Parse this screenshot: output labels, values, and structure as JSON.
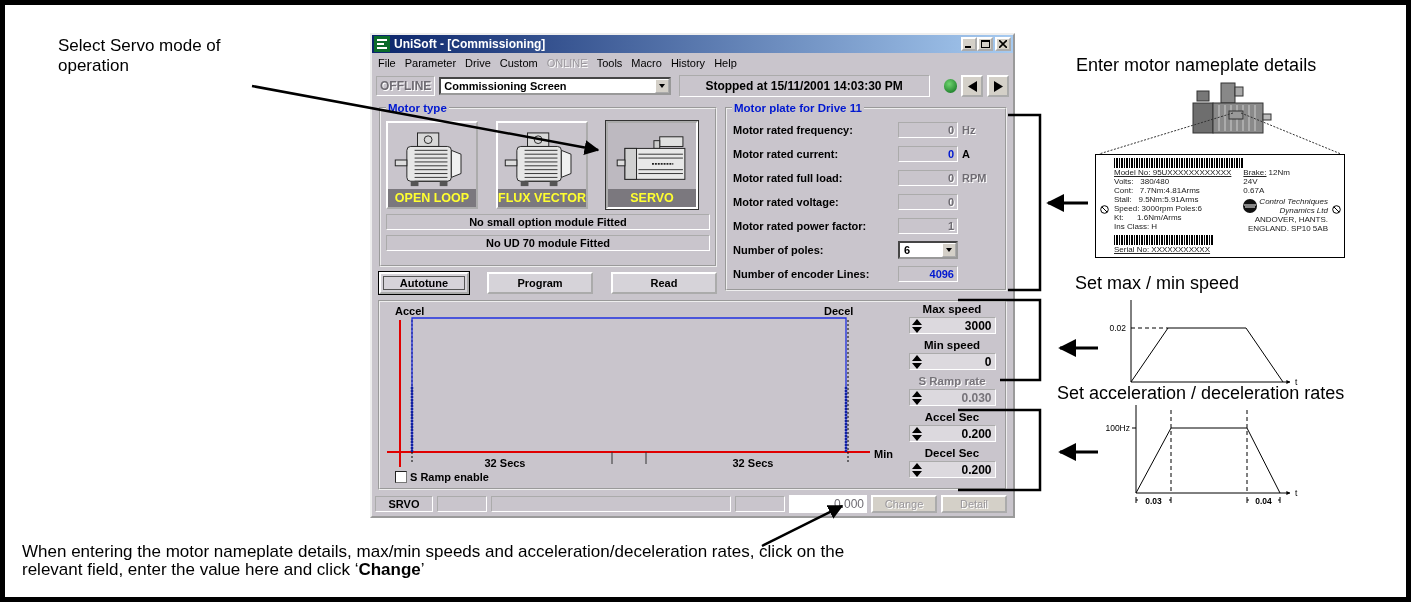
{
  "annotations": {
    "servo_note": "Select Servo mode of operation",
    "change_note": "When entering the motor nameplate details, max/min speeds and acceleration/deceleration rates, click on the relevant field, enter the value here and click ‘**Change**’"
  },
  "window": {
    "title": "UniSoft - [Commissioning]",
    "menu": [
      {
        "label": "File",
        "disabled": false
      },
      {
        "label": "Parameter",
        "disabled": false
      },
      {
        "label": "Drive",
        "disabled": false
      },
      {
        "label": "Custom",
        "disabled": false
      },
      {
        "label": "ONLINE",
        "disabled": true
      },
      {
        "label": "Tools",
        "disabled": false
      },
      {
        "label": "Macro",
        "disabled": false
      },
      {
        "label": "History",
        "disabled": false
      },
      {
        "label": "Help",
        "disabled": false
      }
    ],
    "toolbar": {
      "mode": "OFFLINE",
      "screen": "Commissioning Screen",
      "status": "Stopped at 15/11/2001 14:03:30 PM"
    },
    "motor_type": {
      "title": "Motor type",
      "options": [
        {
          "label": "OPEN LOOP",
          "kind": "induction",
          "selected": false
        },
        {
          "label": "FLUX VECTOR",
          "kind": "induction",
          "selected": false
        },
        {
          "label": "SERVO",
          "kind": "servo",
          "selected": true
        }
      ],
      "modules": [
        "No small option module Fitted",
        "No UD 70 module Fitted"
      ]
    },
    "buttons": [
      {
        "label": "Autotune",
        "focused": true
      },
      {
        "label": "Program",
        "focused": false
      },
      {
        "label": "Read",
        "focused": false
      }
    ],
    "motor_plate": {
      "title": "Motor plate for Drive 11",
      "fields": [
        {
          "label": "Motor rated frequency:",
          "kind": "text",
          "value": "0",
          "unit": "Hz",
          "disabled": true
        },
        {
          "label": "Motor rated current:",
          "kind": "text",
          "value": "0",
          "unit": "A",
          "disabled": false
        },
        {
          "label": "Motor rated full load:",
          "kind": "text",
          "value": "0",
          "unit": "RPM",
          "disabled": true
        },
        {
          "label": "Motor rated voltage:",
          "kind": "text",
          "value": "0",
          "disabled": true
        },
        {
          "label": "Motor rated power factor:",
          "kind": "text",
          "value": "1",
          "disabled": true
        },
        {
          "label": "Number of poles:",
          "kind": "dropdown",
          "value": "6"
        },
        {
          "label": "Number of encoder Lines:",
          "kind": "text",
          "value": "4096",
          "disabled": false
        }
      ]
    },
    "ramp": {
      "accel_label": "Accel",
      "decel_label": "Decel",
      "axis_label": "Min",
      "durations": [
        "32 Secs",
        "32 Secs"
      ],
      "s_ramp_enable": {
        "label": "S Ramp enable",
        "checked": false
      },
      "spinners": [
        {
          "label": "Max speed",
          "value": "3000",
          "disabled": false
        },
        {
          "label": "Min speed",
          "value": "0",
          "disabled": false
        },
        {
          "label": "S Ramp rate",
          "value": "0.030",
          "disabled": true
        },
        {
          "label": "Accel Sec",
          "value": "0.200",
          "disabled": false
        },
        {
          "label": "Decel Sec",
          "value": "0.200",
          "disabled": false
        }
      ]
    },
    "status_bar": {
      "mode": "SRVO",
      "value": "0.000",
      "buttons": [
        {
          "label": "Change",
          "disabled": true
        },
        {
          "label": "Detail",
          "disabled": true
        }
      ]
    }
  },
  "callouts": {
    "nameplate_title": "Enter motor nameplate details",
    "nameplate": {
      "model": "Model No: 95UXXXXXXXXXXXX",
      "left_lines": [
        "Volts:   380/480",
        "Cont:   7.7Nm:4.81Arms",
        "Stall:   9.5Nm:5.91Arms",
        "Speed: 3000rpm Poles:6",
        "Kt:      1.6Nm/Arms",
        "Ins Class: H"
      ],
      "brake": "Brake:",
      "right_lines": [
        "12Nm",
        "24V",
        "0.67A"
      ],
      "company": [
        "Control Techniques",
        "Dynamics Ltd"
      ],
      "address": [
        "ANDOVER, HANTS.",
        "ENGLAND. SP10 5AB"
      ],
      "serial": "Serial No: XXXXXXXXXXX"
    },
    "speed_title": "Set max / min speed",
    "speed_diagram": {
      "y_label": "0.02",
      "x_label": "t"
    },
    "accel_title": "Set acceleration / deceleration rates",
    "accel_diagram": {
      "y_label": "100Hz",
      "x_label": "t",
      "accel_time": "0.03",
      "decel_time": "0.04"
    }
  }
}
